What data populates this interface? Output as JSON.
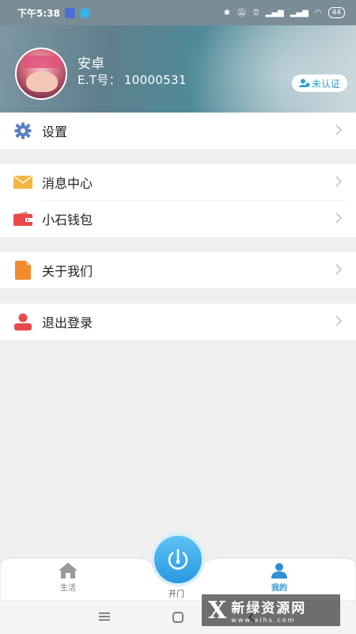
{
  "status_bar": {
    "time": "下午5:38",
    "battery": "44",
    "icons": [
      "bluetooth-icon",
      "mute-icon",
      "alarm-icon",
      "signal-icon",
      "signal-icon",
      "wifi-icon",
      "battery-icon"
    ]
  },
  "profile": {
    "name": "安卓",
    "id_label": "E.T号：",
    "id_value": "10000531",
    "verify_label": "未认证"
  },
  "menu": {
    "settings": "设置",
    "messages": "消息中心",
    "wallet": "小石钱包",
    "about": "关于我们",
    "logout": "退出登录"
  },
  "bottom_nav": {
    "home": "生活",
    "open": "开门",
    "me": "我的"
  },
  "watermark": {
    "name": "新绿资源网",
    "url": "www.xlhs.com"
  },
  "colors": {
    "accent": "#2d8fd5",
    "settings_icon": "#5b7fc9",
    "mail_icon": "#f2b544",
    "wallet_icon": "#e84a4a",
    "about_icon": "#f28a2e",
    "logout_icon": "#e54b4b"
  }
}
